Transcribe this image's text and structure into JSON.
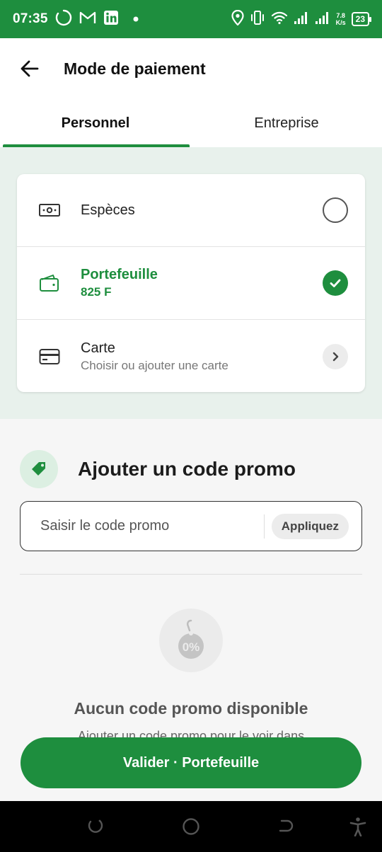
{
  "status_bar": {
    "time": "07:35",
    "speed_value": "7.8",
    "speed_unit": "K/s",
    "battery": "23",
    "icons": [
      "loading-circle-icon",
      "gmail-icon",
      "linkedin-icon",
      "dot-icon",
      "location-icon",
      "vibrate-icon",
      "wifi-icon",
      "signal-icon",
      "signal-icon-2",
      "battery-icon"
    ]
  },
  "header": {
    "title": "Mode de paiement"
  },
  "tabs": [
    {
      "label": "Personnel",
      "active": true
    },
    {
      "label": "Entreprise",
      "active": false
    }
  ],
  "payment_methods": [
    {
      "label": "Espèces",
      "sub": "",
      "state": "unselected",
      "icon": "cash-icon"
    },
    {
      "label": "Portefeuille",
      "sub": "825 F",
      "state": "selected",
      "icon": "wallet-icon"
    },
    {
      "label": "Carte",
      "sub": "Choisir ou ajouter une carte",
      "state": "navigate",
      "icon": "card-icon"
    }
  ],
  "promo": {
    "title": "Ajouter un code promo",
    "placeholder": "Saisir le code promo",
    "apply_label": "Appliquez",
    "empty_title": "Aucun code promo disponible",
    "empty_sub": "Ajouter un code promo pour le voir dans"
  },
  "validate_label": "Valider · Portefeuille",
  "colors": {
    "brand": "#1e8e3e",
    "brand_light": "#e8f1ec"
  }
}
